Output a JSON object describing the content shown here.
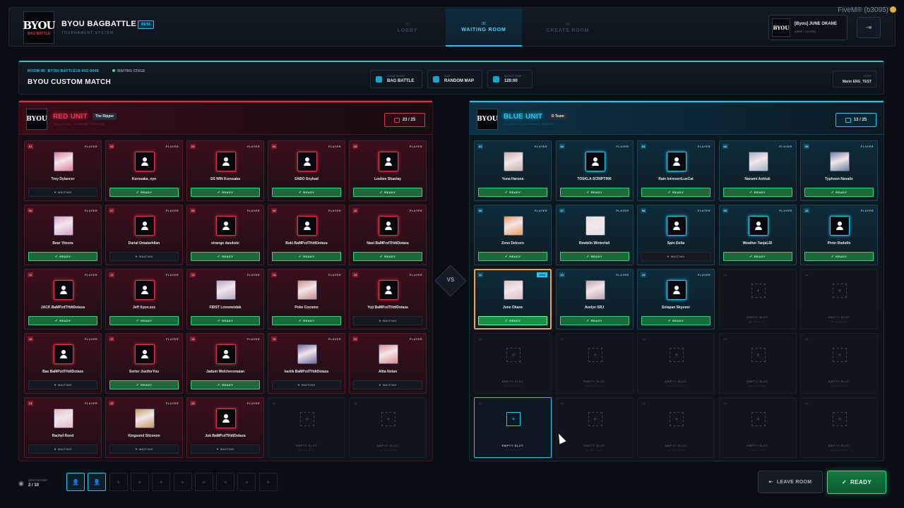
{
  "app": {
    "title": "BYOU BAGBATTLE",
    "beta": "BETA",
    "subtitle": "TOURNAMENT SYSTEM",
    "logo_text": "BYOU",
    "logo_sub": "BAG BATTLE",
    "fivem_label": "FiveM® (b3095)"
  },
  "nav": [
    {
      "num": "01",
      "label": "LOBBY",
      "active": false
    },
    {
      "num": "02",
      "label": "WAITING ROOM",
      "active": true
    },
    {
      "num": "03",
      "label": "CREATE ROOM",
      "active": false
    }
  ],
  "user": {
    "name": "[Byou] JUNE OKANE",
    "status": "#3099 · CITIZEN",
    "avatar_text": "BYOU",
    "logout_icon": "logout-icon"
  },
  "match": {
    "room_id": "ROOM ID: BYOU-BATTLE16-002-8048",
    "stage": "WAITING STAGE",
    "title": "BYOU CUSTOM MATCH",
    "chips": [
      {
        "key": "GAME MODE",
        "value": "BAG BATTLE",
        "icon": "gamepad-icon"
      },
      {
        "key": "MAP",
        "value": "RANDOM MAP",
        "icon": "map-icon"
      },
      {
        "key": "MATCH TIME",
        "value": "120:00",
        "icon": "clock-icon"
      }
    ],
    "host_key": "HOST",
    "host_value": "Mario ENG_TEST"
  },
  "red_team": {
    "name": "RED UNIT",
    "tag": "The Ripper",
    "subtitle": "TACTICAL COMBAT SQUAD",
    "count": "23 / 25",
    "color": "#e2334d",
    "slots": [
      {
        "n": "01",
        "name": "Troy Dylancer",
        "status": "WAITING",
        "avatar": "photo",
        "photo": "#e07a9a"
      },
      {
        "n": "02",
        "name": "Kurosaka_oyo",
        "status": "READY",
        "avatar": "default"
      },
      {
        "n": "03",
        "name": "SS WIN Kurosaka",
        "status": "READY",
        "avatar": "default"
      },
      {
        "n": "04",
        "name": "SABO Soybad",
        "status": "READY",
        "avatar": "default"
      },
      {
        "n": "05",
        "name": "Lookee Shaolay",
        "status": "READY",
        "avatar": "default"
      },
      {
        "n": "06",
        "name": "Bear Yitsora",
        "status": "READY",
        "avatar": "photo",
        "photo": "#d9a0c8"
      },
      {
        "n": "07",
        "name": "Darial Omatarhilan",
        "status": "WAITING",
        "avatar": "default"
      },
      {
        "n": "08",
        "name": "strange dasdsdc",
        "status": "READY",
        "avatar": "default"
      },
      {
        "n": "09",
        "name": "Buki BaMPzdTHdtDotaza",
        "status": "READY",
        "avatar": "default"
      },
      {
        "n": "10",
        "name": "Nast BaMPzdTHdtDotaza",
        "status": "READY",
        "avatar": "default"
      },
      {
        "n": "11",
        "name": "JACK BaMPzdTHdtDotaza",
        "status": "READY",
        "avatar": "default"
      },
      {
        "n": "12",
        "name": "Jeff Xyon.xxx",
        "status": "READY",
        "avatar": "default"
      },
      {
        "n": "13",
        "name": "FIRST Lovemetdak",
        "status": "READY",
        "avatar": "photo",
        "photo": "#b7a9c4"
      },
      {
        "n": "14",
        "name": "Poke Cocomo",
        "status": "READY",
        "avatar": "photo",
        "photo": "#c98a84"
      },
      {
        "n": "15",
        "name": "Yuji BaMPzdTHdtDotaza",
        "status": "WAITING",
        "avatar": "default"
      },
      {
        "n": "16",
        "name": "Bas BaMPzdTHdtDotaza",
        "status": "WAITING",
        "avatar": "default"
      },
      {
        "n": "17",
        "name": "Sorter JustforYou",
        "status": "READY",
        "avatar": "default"
      },
      {
        "n": "18",
        "name": "Jadum Welchersmaian",
        "status": "READY",
        "avatar": "default"
      },
      {
        "n": "19",
        "name": "kartik BaMPzdTHdtDotaza",
        "status": "WAITING",
        "avatar": "photo",
        "photo": "#6f6aa0"
      },
      {
        "n": "20",
        "name": "Alita Nolan",
        "status": "WAITING",
        "avatar": "photo",
        "photo": "#d88d94"
      },
      {
        "n": "21",
        "name": "Rachel Rond",
        "status": "WAITING",
        "avatar": "photo",
        "photo": "#e4b9c9"
      },
      {
        "n": "22",
        "name": "Kingsond Sitzovon",
        "status": "WAITING",
        "avatar": "photo",
        "photo": "#c79a63"
      },
      {
        "n": "23",
        "name": "Juk BaMPzdTHdtDotaza",
        "status": "WAITING",
        "avatar": "default"
      },
      {
        "n": "24",
        "empty": true
      },
      {
        "n": "25",
        "empty": true
      }
    ]
  },
  "blue_team": {
    "name": "BLUE UNIT",
    "tag": "D Team",
    "subtitle": "TACTICAL COMBAT SQUAD",
    "count": "13 / 25",
    "color": "#1ec8f0",
    "slots": [
      {
        "n": "01",
        "name": "Yuna Haruna",
        "status": "READY",
        "avatar": "photo",
        "photo": "#c7b0a8"
      },
      {
        "n": "02",
        "name": "TOSKLA SCRIPT990",
        "status": "READY",
        "avatar": "default"
      },
      {
        "n": "03",
        "name": "Rain IntrovertLuvCat",
        "status": "READY",
        "avatar": "default"
      },
      {
        "n": "04",
        "name": "Nanami Ashiub",
        "status": "READY",
        "avatar": "photo",
        "photo": "#9fb3c8"
      },
      {
        "n": "05",
        "name": "Typhoon Navalix",
        "status": "READY",
        "avatar": "photo",
        "photo": "#6f7fa6"
      },
      {
        "n": "06",
        "name": "Zeno Delcoro",
        "status": "READY",
        "avatar": "photo",
        "photo": "#e49a5a"
      },
      {
        "n": "07",
        "name": "Rewbilo Winterfall",
        "status": "READY",
        "avatar": "photo",
        "photo": "#dfe3ea"
      },
      {
        "n": "08",
        "name": "Spin Delta",
        "status": "WAITING",
        "avatar": "default"
      },
      {
        "n": "09",
        "name": "Weather TanjaLID",
        "status": "READY",
        "avatar": "default"
      },
      {
        "n": "10",
        "name": "Pinto Rodolfo",
        "status": "READY",
        "avatar": "default"
      },
      {
        "n": "11",
        "name": "June Okane",
        "status": "READY",
        "avatar": "photo",
        "photo": "#d9c2c6",
        "you": true
      },
      {
        "n": "12",
        "name": "Avelyn SRJ",
        "status": "READY",
        "avatar": "photo",
        "photo": "#c3a4ae"
      },
      {
        "n": "13",
        "name": "Solapan Skyover",
        "status": "READY",
        "avatar": "default"
      },
      {
        "n": "14",
        "empty": true
      },
      {
        "n": "15",
        "empty": true
      },
      {
        "n": "16",
        "empty": true
      },
      {
        "n": "17",
        "empty": true
      },
      {
        "n": "18",
        "empty": true
      },
      {
        "n": "19",
        "empty": true
      },
      {
        "n": "20",
        "empty": true
      },
      {
        "n": "21",
        "empty": true,
        "selected": true
      },
      {
        "n": "22",
        "empty": true
      },
      {
        "n": "23",
        "empty": true
      },
      {
        "n": "24",
        "empty": true
      },
      {
        "n": "25",
        "empty": true
      }
    ]
  },
  "labels": {
    "player": "PLAYER",
    "you": "YOU",
    "ready": "READY",
    "waiting": "WAITING",
    "empty": "EMPTY SLOT",
    "select": "SELECT SLOT",
    "vs": "VS"
  },
  "spectators": {
    "label": "SPECTATORS",
    "count": "2 / 10",
    "filled": 2,
    "total": 10
  },
  "actions": {
    "leave": "LEAVE ROOM",
    "ready": "READY"
  }
}
